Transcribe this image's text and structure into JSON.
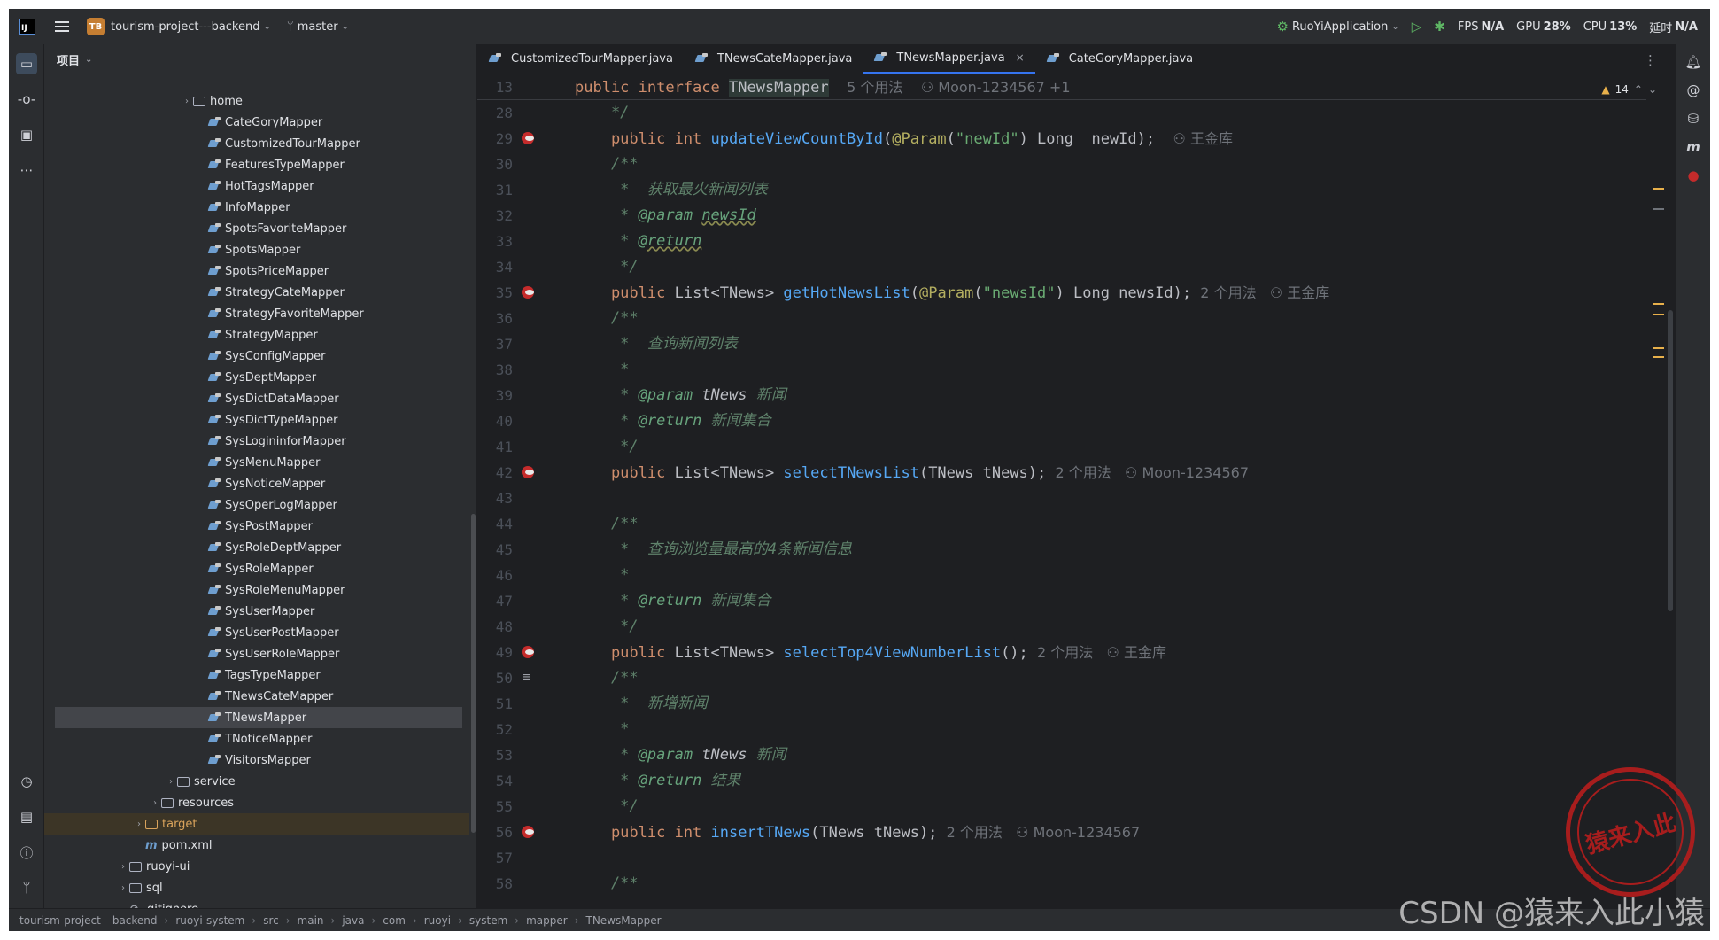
{
  "titlebar": {
    "project_badge": "TB",
    "project_name": "tourism-project---backend",
    "branch": "master",
    "run_config": "RuoYiApplication",
    "fps_label": "FPS",
    "fps_value": "N/A",
    "gpu_label": "GPU",
    "gpu_value": "28%",
    "cpu_label": "CPU",
    "cpu_value": "13%",
    "timer_label": "延时",
    "timer_value": "N/A"
  },
  "project_panel": {
    "title": "项目",
    "tree": [
      {
        "label": "home",
        "kind": "folder",
        "indent": 1,
        "arrow": "›"
      },
      {
        "label": "CateGoryMapper",
        "kind": "mapper",
        "indent": 2
      },
      {
        "label": "CustomizedTourMapper",
        "kind": "mapper",
        "indent": 2
      },
      {
        "label": "FeaturesTypeMapper",
        "kind": "mapper",
        "indent": 2
      },
      {
        "label": "HotTagsMapper",
        "kind": "mapper",
        "indent": 2
      },
      {
        "label": "InfoMapper",
        "kind": "mapper",
        "indent": 2
      },
      {
        "label": "SpotsFavoriteMapper",
        "kind": "mapper",
        "indent": 2
      },
      {
        "label": "SpotsMapper",
        "kind": "mapper",
        "indent": 2
      },
      {
        "label": "SpotsPriceMapper",
        "kind": "mapper",
        "indent": 2
      },
      {
        "label": "StrategyCateMapper",
        "kind": "mapper",
        "indent": 2
      },
      {
        "label": "StrategyFavoriteMapper",
        "kind": "mapper",
        "indent": 2
      },
      {
        "label": "StrategyMapper",
        "kind": "mapper",
        "indent": 2
      },
      {
        "label": "SysConfigMapper",
        "kind": "mapper",
        "indent": 2
      },
      {
        "label": "SysDeptMapper",
        "kind": "mapper",
        "indent": 2
      },
      {
        "label": "SysDictDataMapper",
        "kind": "mapper",
        "indent": 2
      },
      {
        "label": "SysDictTypeMapper",
        "kind": "mapper",
        "indent": 2
      },
      {
        "label": "SysLogininforMapper",
        "kind": "mapper",
        "indent": 2
      },
      {
        "label": "SysMenuMapper",
        "kind": "mapper",
        "indent": 2
      },
      {
        "label": "SysNoticeMapper",
        "kind": "mapper",
        "indent": 2
      },
      {
        "label": "SysOperLogMapper",
        "kind": "mapper",
        "indent": 2
      },
      {
        "label": "SysPostMapper",
        "kind": "mapper",
        "indent": 2
      },
      {
        "label": "SysRoleDeptMapper",
        "kind": "mapper",
        "indent": 2
      },
      {
        "label": "SysRoleMapper",
        "kind": "mapper",
        "indent": 2
      },
      {
        "label": "SysRoleMenuMapper",
        "kind": "mapper",
        "indent": 2
      },
      {
        "label": "SysUserMapper",
        "kind": "mapper",
        "indent": 2
      },
      {
        "label": "SysUserPostMapper",
        "kind": "mapper",
        "indent": 2
      },
      {
        "label": "SysUserRoleMapper",
        "kind": "mapper",
        "indent": 2
      },
      {
        "label": "TagsTypeMapper",
        "kind": "mapper",
        "indent": 2
      },
      {
        "label": "TNewsCateMapper",
        "kind": "mapper",
        "indent": 2
      },
      {
        "label": "TNewsMapper",
        "kind": "mapper",
        "indent": 2,
        "selected": true
      },
      {
        "label": "TNoticeMapper",
        "kind": "mapper",
        "indent": 2
      },
      {
        "label": "VisitorsMapper",
        "kind": "mapper",
        "indent": 2
      },
      {
        "label": "service",
        "kind": "folder",
        "indent": 0,
        "arrow": "›"
      },
      {
        "label": "resources",
        "kind": "folder",
        "indent": -1,
        "arrow": "›"
      },
      {
        "label": "target",
        "kind": "folder-orange",
        "indent": -2,
        "arrow": "›",
        "target": true
      },
      {
        "label": "pom.xml",
        "kind": "maven",
        "indent": -2
      },
      {
        "label": "ruoyi-ui",
        "kind": "folder",
        "indent": -3,
        "arrow": "›"
      },
      {
        "label": "sql",
        "kind": "folder",
        "indent": -3,
        "arrow": "›"
      },
      {
        "label": ".gitignore",
        "kind": "file",
        "indent": -3
      }
    ]
  },
  "tabs": [
    {
      "label": "CustomizedTourMapper.java",
      "active": false
    },
    {
      "label": "TNewsCateMapper.java",
      "active": false
    },
    {
      "label": "TNewsMapper.java",
      "active": true,
      "close": "×"
    },
    {
      "label": "CateGoryMapper.java",
      "active": false
    }
  ],
  "sticky": {
    "line_number": "13",
    "kw": "public interface ",
    "name": "TNewsMapper",
    "hint": "5 个用法",
    "author": "Moon-1234567 +1"
  },
  "inspection": {
    "warnings": "14"
  },
  "code_lines": [
    {
      "n": "28",
      "g": "",
      "parts": [
        [
          "cm",
          "    */"
        ]
      ]
    },
    {
      "n": "29",
      "g": "bird",
      "parts": [
        [
          "kw",
          "    public int "
        ],
        [
          "fn",
          "updateViewCountById"
        ],
        [
          "ty",
          "("
        ],
        [
          "an",
          "@Param"
        ],
        [
          "ty",
          "("
        ],
        [
          "str",
          "\"newId\""
        ],
        [
          "ty",
          ") Long  newId); "
        ],
        [
          "hint",
          "  ⚇ 王金库"
        ]
      ]
    },
    {
      "n": "30",
      "g": "",
      "parts": [
        [
          "cm",
          "    /**"
        ]
      ]
    },
    {
      "n": "31",
      "g": "",
      "parts": [
        [
          "cm",
          "     *  获取最火新闻列表"
        ]
      ]
    },
    {
      "n": "32",
      "g": "",
      "parts": [
        [
          "cm",
          "     * "
        ],
        [
          "tagp",
          "@param "
        ],
        [
          "tag",
          "newsId"
        ]
      ]
    },
    {
      "n": "33",
      "g": "",
      "parts": [
        [
          "cm",
          "     * "
        ],
        [
          "tag",
          "@return"
        ]
      ]
    },
    {
      "n": "34",
      "g": "",
      "parts": [
        [
          "cm",
          "     */"
        ]
      ]
    },
    {
      "n": "35",
      "g": "bird",
      "parts": [
        [
          "kw",
          "    public "
        ],
        [
          "ty",
          "List<TNews> "
        ],
        [
          "fn",
          "getHotNewsList"
        ],
        [
          "ty",
          "("
        ],
        [
          "an",
          "@Param"
        ],
        [
          "ty",
          "("
        ],
        [
          "str",
          "\"newsId\""
        ],
        [
          "ty",
          ") Long newsId); "
        ],
        [
          "hint",
          "2 个用法   ⚇ 王金库"
        ]
      ]
    },
    {
      "n": "36",
      "g": "",
      "parts": [
        [
          "cm",
          "    /**"
        ]
      ]
    },
    {
      "n": "37",
      "g": "",
      "parts": [
        [
          "cm",
          "     *  查询新闻列表"
        ]
      ]
    },
    {
      "n": "38",
      "g": "",
      "parts": [
        [
          "cm",
          "     *"
        ]
      ]
    },
    {
      "n": "39",
      "g": "",
      "parts": [
        [
          "cm",
          "     * "
        ],
        [
          "tagp",
          "@param "
        ],
        [
          "par",
          "tNews "
        ],
        [
          "cm",
          "新闻"
        ]
      ]
    },
    {
      "n": "40",
      "g": "",
      "parts": [
        [
          "cm",
          "     * "
        ],
        [
          "tagp",
          "@return "
        ],
        [
          "cm",
          "新闻集合"
        ]
      ]
    },
    {
      "n": "41",
      "g": "",
      "parts": [
        [
          "cm",
          "     */"
        ]
      ]
    },
    {
      "n": "42",
      "g": "bird",
      "parts": [
        [
          "kw",
          "    public "
        ],
        [
          "ty",
          "List<TNews> "
        ],
        [
          "fn",
          "selectTNewsList"
        ],
        [
          "ty",
          "(TNews tNews); "
        ],
        [
          "hint",
          "2 个用法   ⚇ Moon-1234567"
        ]
      ]
    },
    {
      "n": "43",
      "g": "",
      "parts": [
        [
          "ty",
          ""
        ]
      ]
    },
    {
      "n": "44",
      "g": "",
      "parts": [
        [
          "cm",
          "    /**"
        ]
      ]
    },
    {
      "n": "45",
      "g": "",
      "parts": [
        [
          "cm",
          "     *  查询浏览量最高的4条新闻信息"
        ]
      ]
    },
    {
      "n": "46",
      "g": "",
      "parts": [
        [
          "cm",
          "     *"
        ]
      ]
    },
    {
      "n": "47",
      "g": "",
      "parts": [
        [
          "cm",
          "     * "
        ],
        [
          "tagp",
          "@return "
        ],
        [
          "cm",
          "新闻集合"
        ]
      ]
    },
    {
      "n": "48",
      "g": "",
      "parts": [
        [
          "cm",
          "     */"
        ]
      ]
    },
    {
      "n": "49",
      "g": "bird",
      "parts": [
        [
          "kw",
          "    public "
        ],
        [
          "ty",
          "List<TNews> "
        ],
        [
          "fn",
          "selectTop4ViewNumberList"
        ],
        [
          "ty",
          "(); "
        ],
        [
          "hint",
          "2 个用法   ⚇ 王金库"
        ]
      ]
    },
    {
      "n": "50",
      "g": "doc",
      "parts": [
        [
          "cm",
          "    /**"
        ]
      ]
    },
    {
      "n": "51",
      "g": "",
      "parts": [
        [
          "cm",
          "     *  新增新闻"
        ]
      ]
    },
    {
      "n": "52",
      "g": "",
      "parts": [
        [
          "cm",
          "     *"
        ]
      ]
    },
    {
      "n": "53",
      "g": "",
      "parts": [
        [
          "cm",
          "     * "
        ],
        [
          "tagp",
          "@param "
        ],
        [
          "par",
          "tNews "
        ],
        [
          "cm",
          "新闻"
        ]
      ]
    },
    {
      "n": "54",
      "g": "",
      "parts": [
        [
          "cm",
          "     * "
        ],
        [
          "tagp",
          "@return "
        ],
        [
          "cm",
          "结果"
        ]
      ]
    },
    {
      "n": "55",
      "g": "",
      "parts": [
        [
          "cm",
          "     */"
        ]
      ]
    },
    {
      "n": "56",
      "g": "bird",
      "parts": [
        [
          "kw",
          "    public int "
        ],
        [
          "fn",
          "insertTNews"
        ],
        [
          "ty",
          "(TNews tNews); "
        ],
        [
          "hint",
          "2 个用法   ⚇ Moon-1234567"
        ]
      ]
    },
    {
      "n": "57",
      "g": "",
      "parts": [
        [
          "ty",
          ""
        ]
      ]
    },
    {
      "n": "58",
      "g": "",
      "parts": [
        [
          "cm",
          "    /**"
        ]
      ]
    }
  ],
  "breadcrumb": [
    "tourism-project---backend",
    "ruoyi-system",
    "src",
    "main",
    "java",
    "com",
    "ruoyi",
    "system",
    "mapper",
    "TNewsMapper"
  ],
  "watermark": "CSDN @猿来入此小猿",
  "stamp_text": "猿来入此",
  "colors": {
    "accent": "#3574f0",
    "keyword": "#cf8e6d",
    "function": "#56a8f5",
    "string": "#6aab73",
    "comment": "#5f826b",
    "annotation": "#b3ae60"
  }
}
